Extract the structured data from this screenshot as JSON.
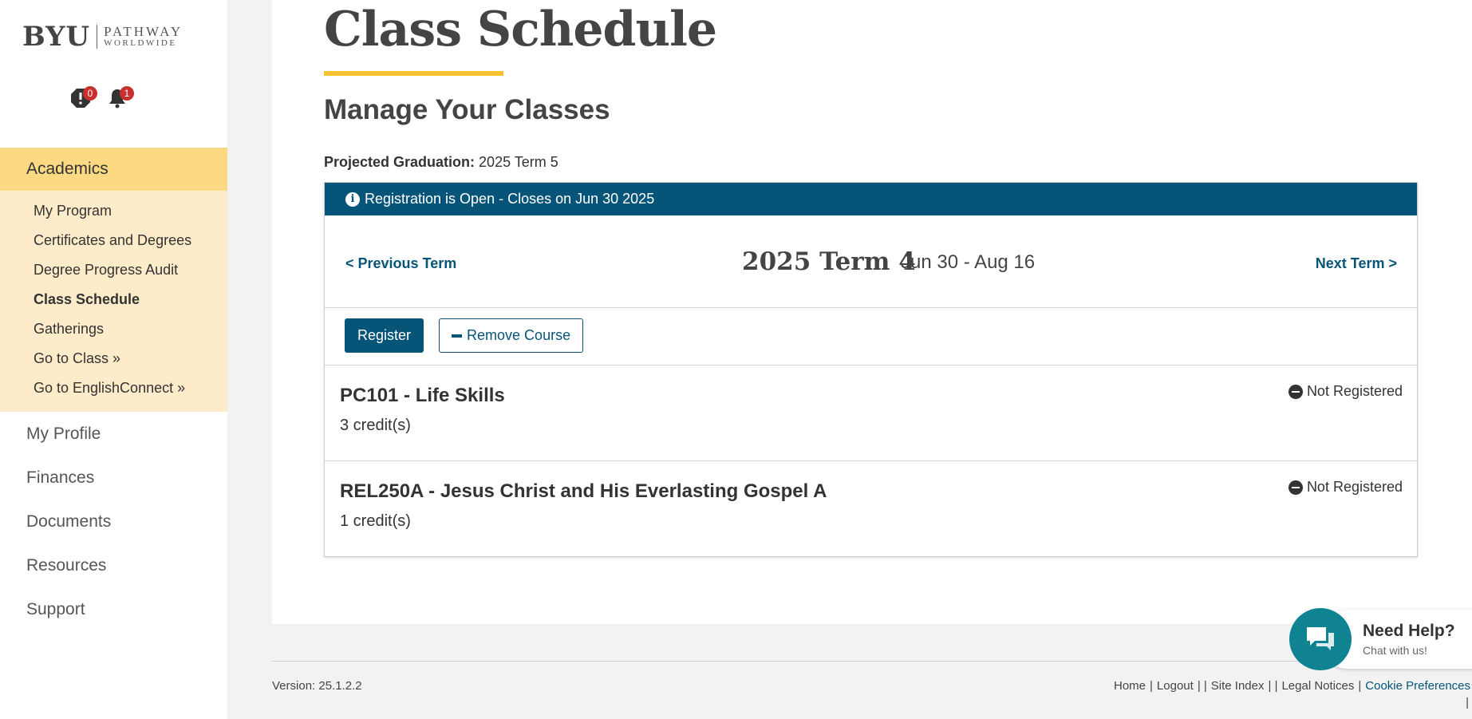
{
  "brand": {
    "logo_main": "BYU",
    "logo_line1": "PATHWAY",
    "logo_line2": "WORLDWIDE"
  },
  "alerts": {
    "warning_count": "0",
    "notification_count": "1"
  },
  "sidebar": {
    "section": "Academics",
    "sub_items": [
      {
        "label": "My Program"
      },
      {
        "label": "Certificates and Degrees"
      },
      {
        "label": "Degree Progress Audit"
      },
      {
        "label": "Class Schedule"
      },
      {
        "label": "Gatherings"
      },
      {
        "label": "Go to Class »"
      },
      {
        "label": "Go to EnglishConnect »"
      }
    ],
    "main_items": [
      {
        "label": "My Profile"
      },
      {
        "label": "Finances"
      },
      {
        "label": "Documents"
      },
      {
        "label": "Resources"
      },
      {
        "label": "Support"
      }
    ]
  },
  "page": {
    "title": "Class Schedule",
    "section_title": "Manage Your Classes",
    "projected_label": "Projected Graduation:",
    "projected_value": "2025 Term 5"
  },
  "registration": {
    "banner": "Registration is Open - Closes on Jun 30 2025"
  },
  "term": {
    "prev_label": "< Previous Term",
    "name": "2025 Term 4",
    "dates": "Jun 30 - Aug 16",
    "next_label": "Next Term >"
  },
  "actions": {
    "register_label": "Register",
    "remove_label": "Remove Course"
  },
  "courses": [
    {
      "title": "PC101 - Life Skills",
      "credits": "3 credit(s)",
      "status": "Not Registered"
    },
    {
      "title": "REL250A - Jesus Christ and His Everlasting Gospel A",
      "credits": "1 credit(s)",
      "status": "Not Registered"
    }
  ],
  "footer": {
    "version": "Version: 25.1.2.2",
    "links": [
      "Home",
      "Logout",
      "Site Index",
      "Legal Notices",
      "Cookie Preferences"
    ]
  },
  "chat": {
    "title": "Need Help?",
    "subtitle": "Chat with us!"
  },
  "colors": {
    "primary": "#065578",
    "accent": "#f8c230",
    "nav_active": "#fcd982",
    "nav_sub": "#feebc9",
    "chat": "#108392",
    "badge": "#c8302f"
  }
}
